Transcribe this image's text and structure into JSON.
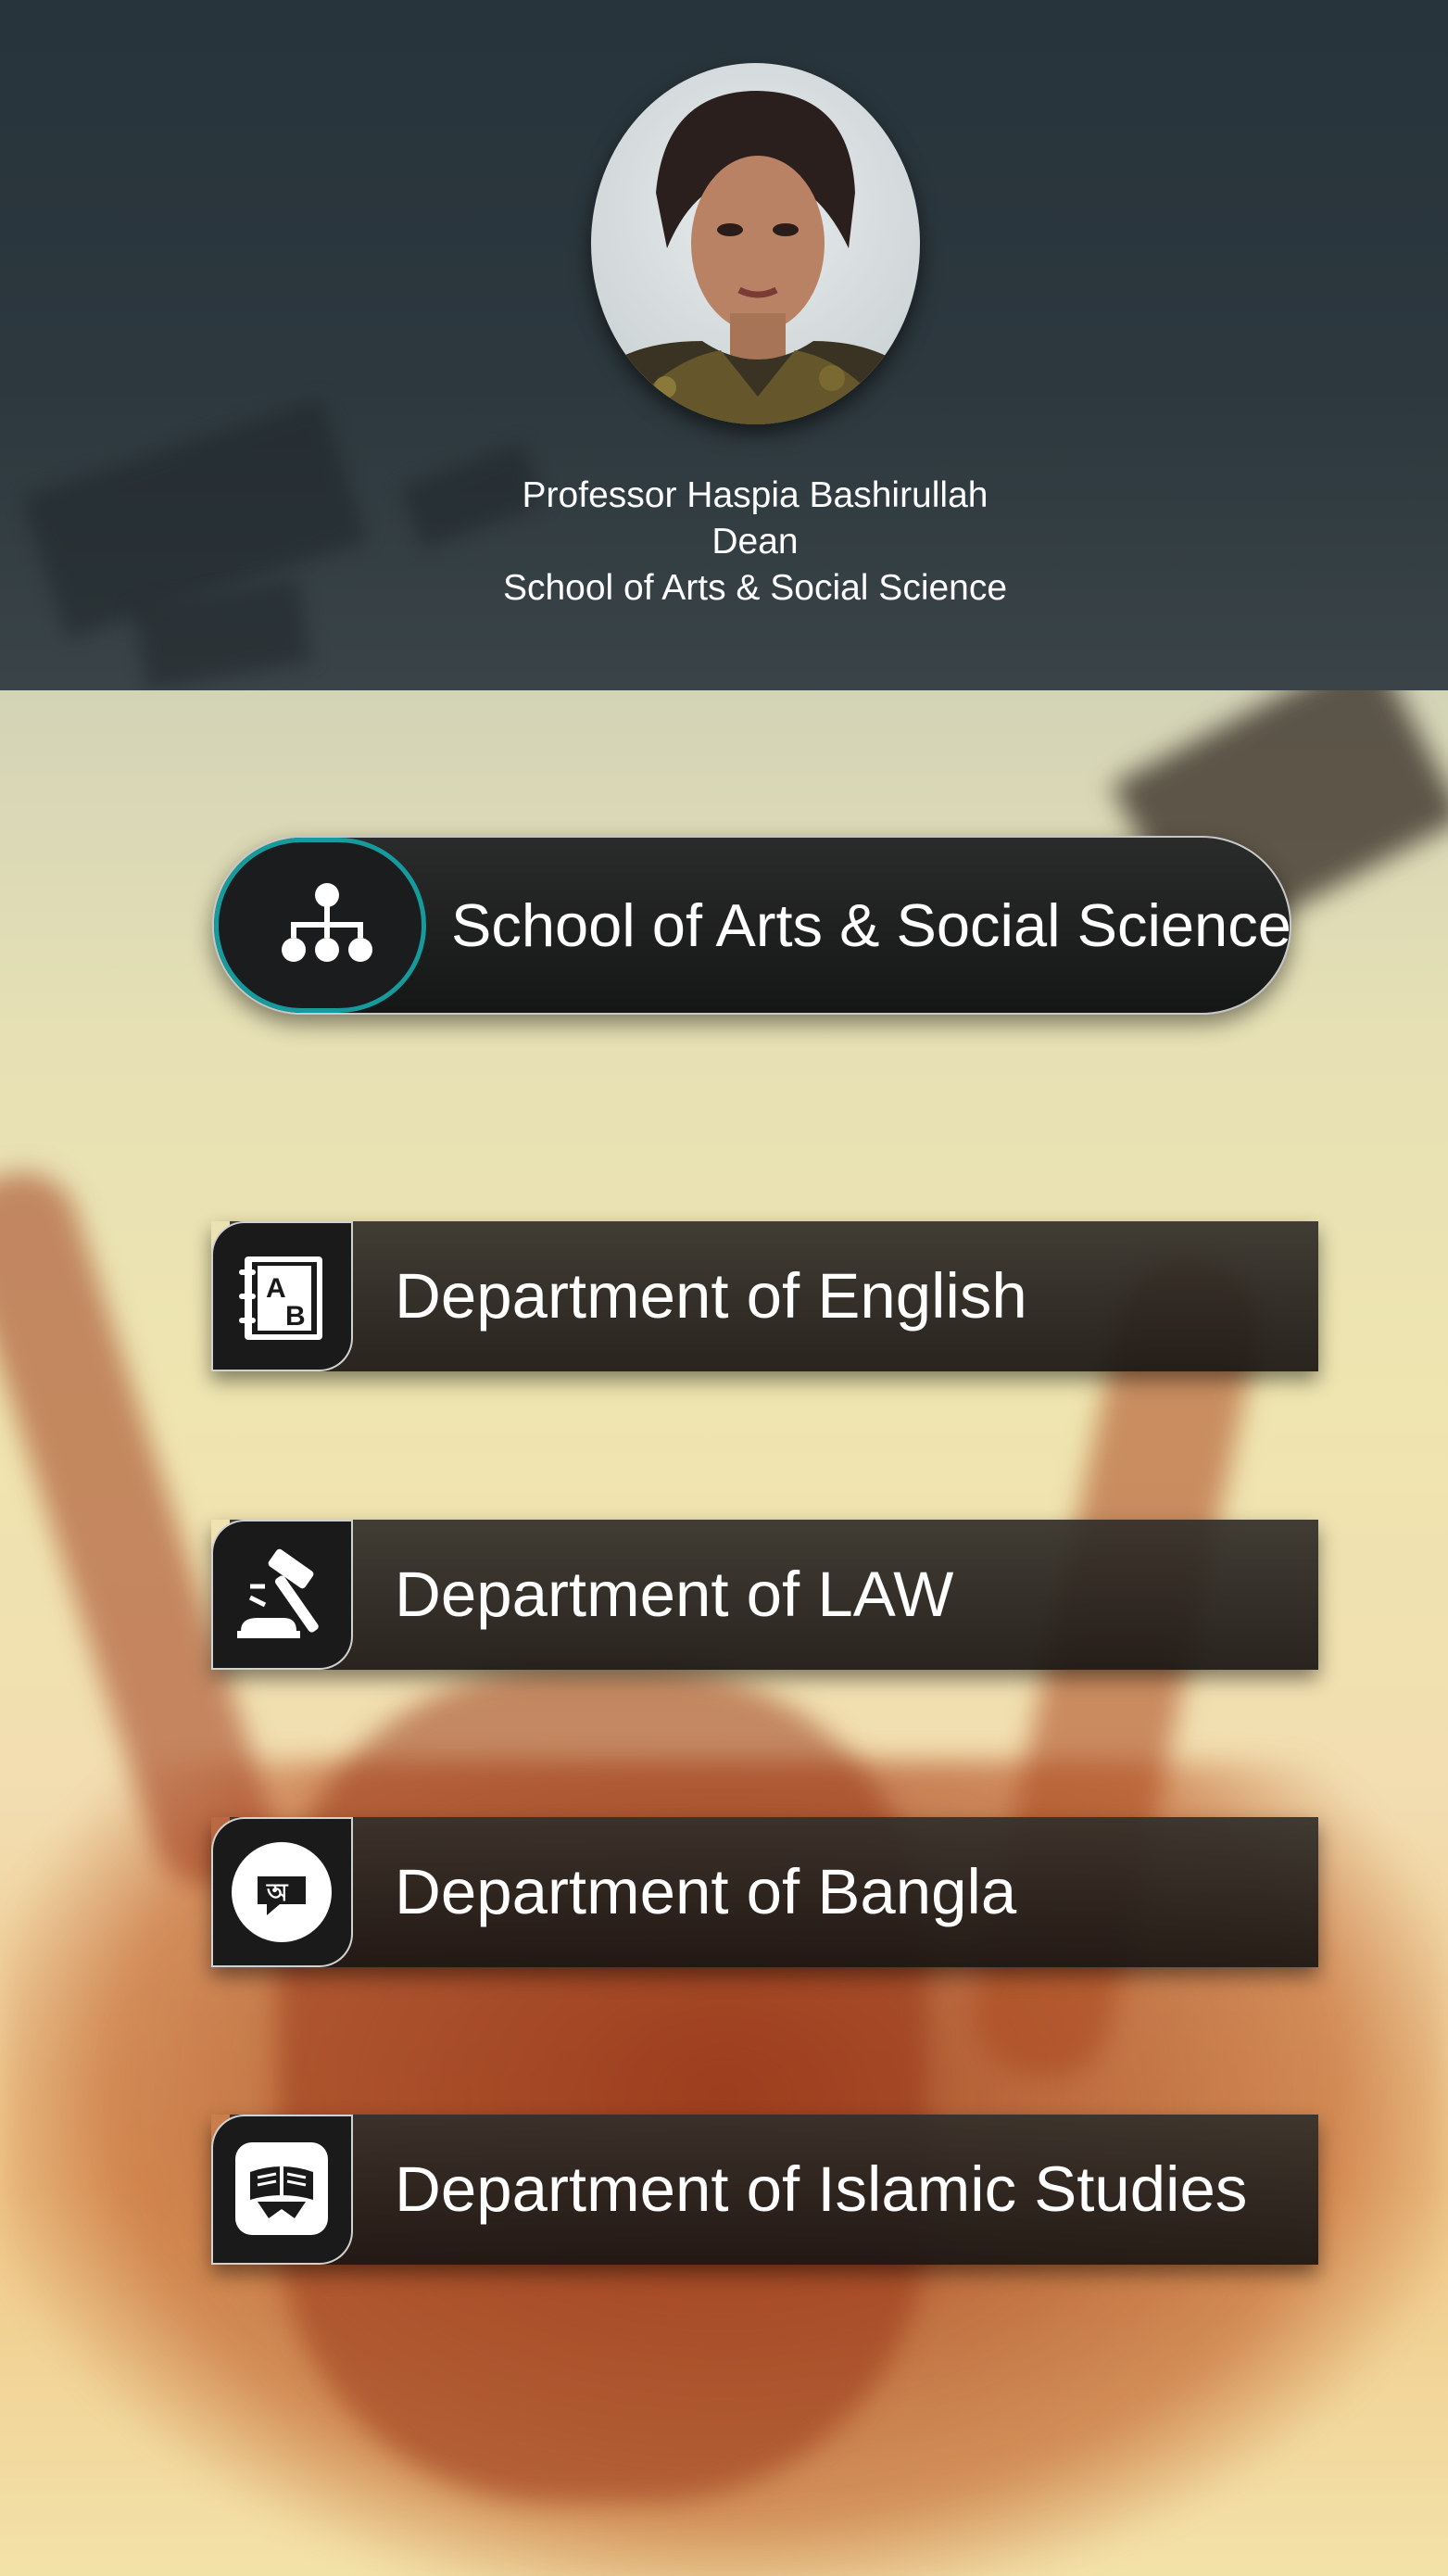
{
  "profile": {
    "name": "Professor Haspia Bashirullah",
    "position": "Dean",
    "school": "School of Arts & Social Science"
  },
  "school_button": {
    "label": "School of Arts & Social Science",
    "icon": "hierarchy-icon",
    "accent_color": "#169a9c"
  },
  "departments": [
    {
      "label": "Department of English",
      "icon": "ab-notebook-icon"
    },
    {
      "label": "Department of LAW",
      "icon": "gavel-icon"
    },
    {
      "label": "Department of Bangla",
      "icon": "bangla-chat-icon"
    },
    {
      "label": "Department of Islamic Studies",
      "icon": "quran-book-icon"
    }
  ]
}
